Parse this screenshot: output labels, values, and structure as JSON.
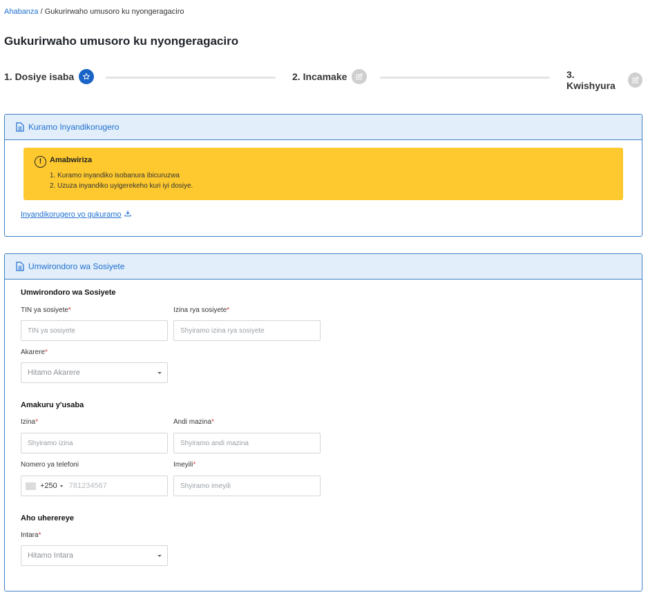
{
  "breadcrumb": {
    "home": "Ahabanza",
    "separator": "/",
    "current": "Gukurirwaho umusoro ku nyongeragaciro"
  },
  "page_title": "Gukurirwaho umusoro ku nyongeragaciro",
  "steps": [
    {
      "label": "1. Dosiye isaba",
      "icon": "star-icon",
      "active": true
    },
    {
      "label": "2. Incamake",
      "icon": "edit-icon",
      "active": false
    },
    {
      "label": "3. Kwishyura",
      "icon": "edit-icon",
      "active": false
    }
  ],
  "download_card": {
    "title": "Kuramo Inyandikorugero",
    "alert": {
      "title": "Amabwiriza",
      "items": [
        "1. Kuramo inyandiko isobanura ibicuruzwa",
        "2. Uzuza inyandiko uyigerekeho kuri iyi dosiye."
      ]
    },
    "link": "Inyandikorugero yo gukuramo"
  },
  "profile_card": {
    "title": "Umwirondoro wa Sosiyete",
    "company_section": "Umwirondoro wa Sosiyete",
    "tin_label": "TIN ya sosiyete",
    "tin_placeholder": "TIN ya sosiyete",
    "company_name_label": "Izina rya sosiyete",
    "company_name_placeholder": "Shyiramo izina rya sosiyete",
    "district_label": "Akarere",
    "district_placeholder": "Hitamo Akarere",
    "applicant_section": "Amakuru y'usaba",
    "first_name_label": "Izina",
    "first_name_placeholder": "Shyiramo izina",
    "other_names_label": "Andi mazina",
    "other_names_placeholder": "Shyiramo andi mazina",
    "phone_label": "Nomero ya telefoni",
    "phone_dial_code": "+250",
    "phone_placeholder": "781234567",
    "email_label": "Imeyili",
    "email_placeholder": "Shyiramo imeyili",
    "location_section": "Aho uherereye",
    "province_label": "Intara",
    "province_placeholder": "Hitamo Intara"
  },
  "required_marker": "*",
  "colors": {
    "accent": "#1a64c6",
    "alert": "#fdc92f",
    "card_header": "#e2eef9",
    "required": "#d9363e"
  }
}
